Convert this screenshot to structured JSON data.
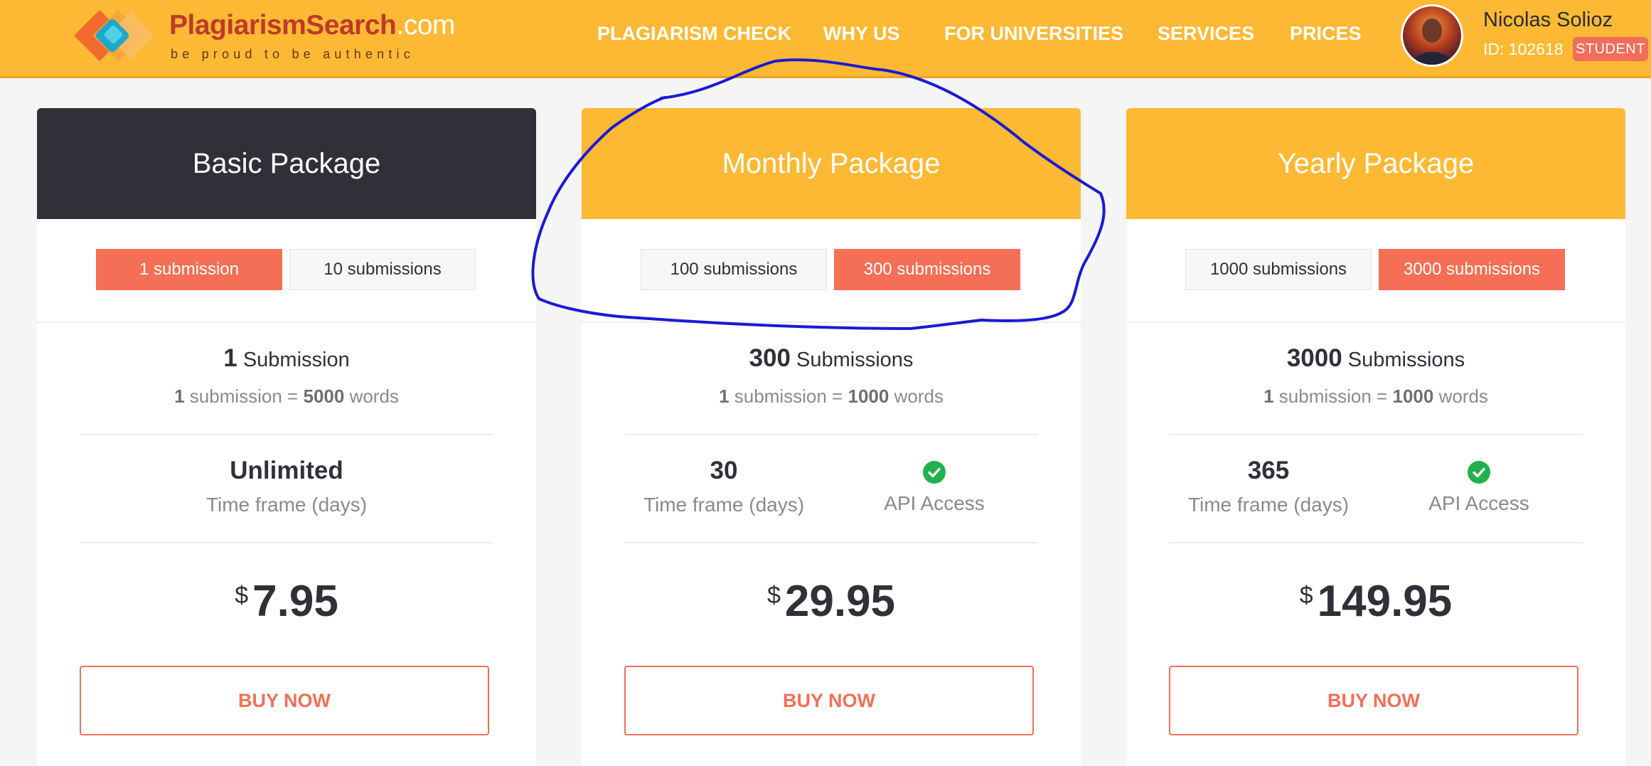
{
  "header": {
    "logo": {
      "name_main": "PlagiarismSearch",
      "name_suffix": ".com",
      "tagline": "be proud to be authentic"
    },
    "nav": [
      "PLAGIARISM CHECK",
      "WHY US",
      "FOR UNIVERSITIES",
      "SERVICES",
      "PRICES"
    ],
    "user": {
      "name": "Nicolas Solioz",
      "id": "ID: 102618",
      "badge": "STUDENT"
    }
  },
  "cards": [
    {
      "title": "Basic Package",
      "tabs": [
        {
          "label": "1 submission",
          "active": true
        },
        {
          "label": "10 submissions",
          "active": false
        }
      ],
      "count": "1",
      "count_label": "Submission",
      "sub_num": "1",
      "sub_mid": "submission =",
      "sub_words": "5000",
      "sub_end": "words",
      "timeframe": "Unlimited",
      "timeframe_label": "Time frame (days)",
      "currency": "$",
      "price": "7.95",
      "buy": "BUY NOW"
    },
    {
      "title": "Monthly Package",
      "tabs": [
        {
          "label": "100 submissions",
          "active": false
        },
        {
          "label": "300 submissions",
          "active": true
        }
      ],
      "count": "300",
      "count_label": "Submissions",
      "sub_num": "1",
      "sub_mid": "submission =",
      "sub_words": "1000",
      "sub_end": "words",
      "timeframe": "30",
      "timeframe_label": "Time frame (days)",
      "api": "API Access",
      "currency": "$",
      "price": "29.95",
      "buy": "BUY NOW"
    },
    {
      "title": "Yearly Package",
      "tabs": [
        {
          "label": "1000 submissions",
          "active": false
        },
        {
          "label": "3000 submissions",
          "active": true
        }
      ],
      "count": "3000",
      "count_label": "Submissions",
      "sub_num": "1",
      "sub_mid": "submission =",
      "sub_words": "1000",
      "sub_end": "words",
      "timeframe": "365",
      "timeframe_label": "Time frame (days)",
      "api": "API Access",
      "currency": "$",
      "price": "149.95",
      "buy": "BUY NOW"
    }
  ],
  "colors": {
    "header_bg": "#fdb933",
    "dark_head": "#2f3038",
    "accent": "#f46f56",
    "check": "#22b14c",
    "annotation": "#1a1ad6"
  }
}
